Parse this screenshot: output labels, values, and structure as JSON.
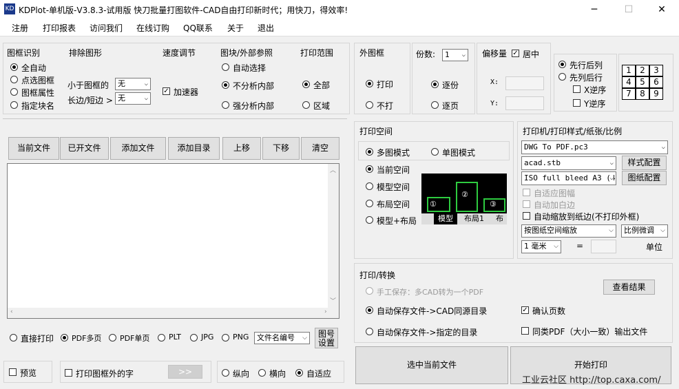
{
  "window": {
    "title": "KDPlot-单机版-V3.8.3-试用版 快刀批量打图软件-CAD自由打印新时代；用快刀，得效率!",
    "icon_name": "kdplot-app-icon",
    "icon_text": "KD",
    "controls": {
      "minimize": "─",
      "maximize": "☐",
      "close": "✕"
    }
  },
  "menu": [
    "注册",
    "打印报表",
    "访问我们",
    "在线订购",
    "QQ联系",
    "关于",
    "退出"
  ],
  "frame_recognition": {
    "title": "图框识别",
    "options": [
      "全自动",
      "点选图框",
      "图框属性",
      "指定块名"
    ]
  },
  "exclude_shapes": {
    "title": "排除图形",
    "less_than_label": "小于图框的",
    "less_value": "无",
    "side_label": "长边/短边 >",
    "side_value": "无"
  },
  "speed": {
    "title": "速度调节",
    "accelerator_label": "加速器"
  },
  "block_ref": {
    "title": "图块/外部参照",
    "options": [
      "自动选择",
      "不分析内部",
      "强分析内部"
    ]
  },
  "print_range": {
    "title": "打印范围",
    "options": [
      "全部",
      "区域"
    ]
  },
  "outer_frame": {
    "title": "外图框",
    "options": [
      "打印",
      "不打"
    ]
  },
  "copies": {
    "title": "份数:",
    "value": "1",
    "options": [
      "逐份",
      "逐页"
    ]
  },
  "offset": {
    "title": "偏移量",
    "center_label": "居中",
    "x_label": "X:",
    "y_label": "Y:"
  },
  "order": {
    "options": [
      "先行后列",
      "先列后行"
    ],
    "x_reverse": "X逆序",
    "y_reverse": "Y逆序"
  },
  "order_grid": [
    [
      "1",
      "2",
      "3"
    ],
    [
      "4",
      "5",
      "6"
    ],
    [
      "7",
      "8",
      "9"
    ]
  ],
  "file_toolbar": [
    "当前文件",
    "已开文件",
    "添加文件",
    "添加目录",
    "上移",
    "下移",
    "清空"
  ],
  "print_space": {
    "title": "打印空间",
    "mode_options": [
      "多图模式",
      "单图模式"
    ],
    "space_options": [
      "当前空间",
      "模型空间",
      "布局空间",
      "模型+布局"
    ],
    "preview_tabs": [
      "模型",
      "布局1",
      "布"
    ],
    "preview_marks": [
      "①",
      "②",
      "③"
    ]
  },
  "printer": {
    "title": "打印机/打印样式/纸张/比例",
    "device": "DWG To PDF.pc3",
    "style": "acad.stb",
    "style_button": "样式配置",
    "paper": "ISO full bleed A3 (4",
    "paper_button": "图纸配置",
    "adapt_frame": "自适应图幅",
    "auto_white": "自动加白边",
    "fit_paper": "自动缩放到纸边(不打印外框)",
    "scale_mode": "按图纸空间缩放",
    "scale_fine": "比例微调",
    "unit_value": "1 毫米",
    "equals": "=",
    "unit_label": "单位"
  },
  "print_convert": {
    "title": "打印/转换",
    "manual_save": "手工保存：多CAD转为一个PDF",
    "view_result": "查看结果",
    "auto_same_dir": "自动保存文件->CAD同源目录",
    "confirm_pages": "确认页数",
    "auto_specified": "自动保存文件->指定的目录",
    "same_pdf": "同类PDF（大小一致）输出文件"
  },
  "output_row": {
    "options": [
      "直接打印",
      "PDF多页",
      "PDF单页",
      "PLT",
      "JPG",
      "PNG"
    ],
    "naming": "文件名编号",
    "naming_button_line1": "图号",
    "naming_button_line2": "设置"
  },
  "bottom_row": {
    "preview": "预览",
    "print_outside": "打印图框外的字",
    "arrow": ">>",
    "orientation": [
      "纵向",
      "横向",
      "自适应"
    ]
  },
  "actions": {
    "select_current": "选中当前文件",
    "start_print": "开始打印"
  },
  "watermark": "工业云社区 http://top.caxa.com/",
  "colors": {
    "title_icon": "#1b3a8c",
    "preview_bg": "#000000",
    "preview_frame": "#2ecc40"
  }
}
